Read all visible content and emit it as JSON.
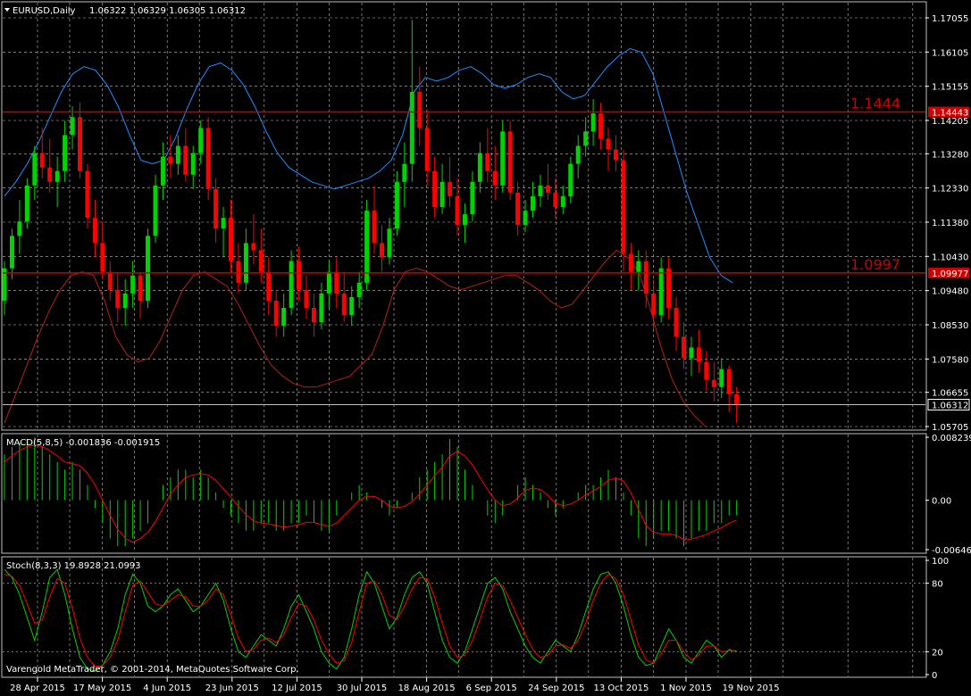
{
  "chart_data": {
    "type": "candlestick",
    "title": "EURUSD,Daily",
    "ohlc_values": "1.06322 1.06329 1.06305 1.06312",
    "colors": {
      "bull": "#00d400",
      "bear": "#ff0000",
      "grid": "#c0c0c0",
      "bb_upper": "#1e90ff",
      "bb_lower": "#b22222",
      "hline": "#cc0000",
      "last": "#c0c0c0"
    },
    "ylim": [
      1.05705,
      1.17055
    ],
    "y_ticks": [
      "1.17055",
      "1.16105",
      "1.15155",
      "1.14205",
      "1.13280",
      "1.12330",
      "1.11380",
      "1.10430",
      "1.09480",
      "1.08530",
      "1.07580",
      "1.06655",
      "1.05705"
    ],
    "x_labels": [
      "28 Apr 2015",
      "17 May 2015",
      "4 Jun 2015",
      "23 Jun 2015",
      "12 Jul 2015",
      "30 Jul 2015",
      "18 Aug 2015",
      "6 Sep 2015",
      "24 Sep 2015",
      "13 Oct 2015",
      "1 Nov 2015",
      "19 Nov 2015"
    ],
    "last_price": {
      "value": 1.06312,
      "label": "1.06312"
    },
    "hlines": [
      {
        "value": 1.1444,
        "tag": "1.14443",
        "label": "1.1444"
      },
      {
        "value": 1.0997,
        "tag": "1.09977",
        "label": "1.0997"
      }
    ],
    "bollinger_upper": [
      1.121,
      1.125,
      1.13,
      1.136,
      1.143,
      1.15,
      1.155,
      1.157,
      1.156,
      1.152,
      1.146,
      1.138,
      1.131,
      1.13,
      1.131,
      1.137,
      1.145,
      1.152,
      1.157,
      1.158,
      1.156,
      1.152,
      1.146,
      1.139,
      1.133,
      1.129,
      1.127,
      1.125,
      1.124,
      1.123,
      1.124,
      1.125,
      1.126,
      1.128,
      1.131,
      1.138,
      1.15,
      1.154,
      1.153,
      1.154,
      1.156,
      1.157,
      1.155,
      1.152,
      1.151,
      1.152,
      1.154,
      1.155,
      1.154,
      1.15,
      1.148,
      1.149,
      1.153,
      1.157,
      1.16,
      1.162,
      1.161,
      1.155,
      1.144,
      1.133,
      1.122,
      1.113,
      1.104,
      1.099,
      1.097
    ],
    "bollinger_lower": [
      1.058,
      1.066,
      1.074,
      1.082,
      1.089,
      1.095,
      1.099,
      1.1,
      1.099,
      1.092,
      1.082,
      1.077,
      1.075,
      1.076,
      1.081,
      1.088,
      1.095,
      1.099,
      1.1,
      1.098,
      1.096,
      1.091,
      1.085,
      1.079,
      1.074,
      1.071,
      1.069,
      1.068,
      1.068,
      1.069,
      1.07,
      1.071,
      1.074,
      1.077,
      1.085,
      1.095,
      1.1,
      1.101,
      1.1,
      1.098,
      1.096,
      1.095,
      1.096,
      1.097,
      1.098,
      1.099,
      1.099,
      1.097,
      1.095,
      1.092,
      1.09,
      1.091,
      1.095,
      1.099,
      1.103,
      1.106,
      1.104,
      1.1,
      1.09,
      1.079,
      1.07,
      1.064,
      1.06,
      1.057
    ],
    "candles": [
      [
        1.092,
        1.103,
        1.088,
        1.101
      ],
      [
        1.101,
        1.112,
        1.098,
        1.11
      ],
      [
        1.11,
        1.12,
        1.105,
        1.114
      ],
      [
        1.114,
        1.126,
        1.112,
        1.124
      ],
      [
        1.124,
        1.135,
        1.12,
        1.133
      ],
      [
        1.133,
        1.14,
        1.126,
        1.129
      ],
      [
        1.129,
        1.137,
        1.122,
        1.125
      ],
      [
        1.125,
        1.132,
        1.118,
        1.128
      ],
      [
        1.128,
        1.142,
        1.125,
        1.138
      ],
      [
        1.138,
        1.146,
        1.134,
        1.143
      ],
      [
        1.143,
        1.147,
        1.126,
        1.128
      ],
      [
        1.128,
        1.13,
        1.112,
        1.115
      ],
      [
        1.115,
        1.12,
        1.104,
        1.108
      ],
      [
        1.108,
        1.114,
        1.098,
        1.1
      ],
      [
        1.1,
        1.103,
        1.092,
        1.095
      ],
      [
        1.095,
        1.1,
        1.086,
        1.09
      ],
      [
        1.09,
        1.098,
        1.085,
        1.094
      ],
      [
        1.094,
        1.103,
        1.09,
        1.099
      ],
      [
        1.099,
        1.1,
        1.087,
        1.092
      ],
      [
        1.092,
        1.112,
        1.09,
        1.11
      ],
      [
        1.11,
        1.127,
        1.108,
        1.124
      ],
      [
        1.124,
        1.136,
        1.12,
        1.132
      ],
      [
        1.132,
        1.138,
        1.126,
        1.13
      ],
      [
        1.13,
        1.138,
        1.127,
        1.135
      ],
      [
        1.135,
        1.14,
        1.125,
        1.127
      ],
      [
        1.127,
        1.135,
        1.123,
        1.133
      ],
      [
        1.133,
        1.142,
        1.13,
        1.14
      ],
      [
        1.14,
        1.143,
        1.12,
        1.123
      ],
      [
        1.123,
        1.126,
        1.108,
        1.112
      ],
      [
        1.112,
        1.118,
        1.104,
        1.115
      ],
      [
        1.115,
        1.12,
        1.1,
        1.103
      ],
      [
        1.103,
        1.108,
        1.094,
        1.097
      ],
      [
        1.097,
        1.112,
        1.095,
        1.108
      ],
      [
        1.108,
        1.116,
        1.102,
        1.106
      ],
      [
        1.106,
        1.112,
        1.097,
        1.1
      ],
      [
        1.1,
        1.104,
        1.088,
        1.092
      ],
      [
        1.092,
        1.095,
        1.082,
        1.085
      ],
      [
        1.085,
        1.094,
        1.082,
        1.09
      ],
      [
        1.09,
        1.106,
        1.088,
        1.103
      ],
      [
        1.103,
        1.107,
        1.092,
        1.095
      ],
      [
        1.095,
        1.099,
        1.087,
        1.09
      ],
      [
        1.09,
        1.094,
        1.082,
        1.086
      ],
      [
        1.086,
        1.097,
        1.084,
        1.094
      ],
      [
        1.094,
        1.103,
        1.09,
        1.1
      ],
      [
        1.1,
        1.104,
        1.09,
        1.094
      ],
      [
        1.094,
        1.1,
        1.086,
        1.088
      ],
      [
        1.088,
        1.096,
        1.085,
        1.093
      ],
      [
        1.093,
        1.1,
        1.09,
        1.097
      ],
      [
        1.097,
        1.12,
        1.095,
        1.117
      ],
      [
        1.117,
        1.124,
        1.105,
        1.108
      ],
      [
        1.108,
        1.113,
        1.1,
        1.104
      ],
      [
        1.104,
        1.115,
        1.102,
        1.112
      ],
      [
        1.112,
        1.128,
        1.11,
        1.125
      ],
      [
        1.125,
        1.136,
        1.118,
        1.13
      ],
      [
        1.13,
        1.17,
        1.125,
        1.15
      ],
      [
        1.15,
        1.157,
        1.135,
        1.14
      ],
      [
        1.14,
        1.145,
        1.124,
        1.128
      ],
      [
        1.128,
        1.132,
        1.115,
        1.118
      ],
      [
        1.118,
        1.13,
        1.116,
        1.125
      ],
      [
        1.125,
        1.132,
        1.118,
        1.121
      ],
      [
        1.121,
        1.126,
        1.11,
        1.113
      ],
      [
        1.113,
        1.119,
        1.108,
        1.116
      ],
      [
        1.116,
        1.128,
        1.114,
        1.125
      ],
      [
        1.125,
        1.136,
        1.122,
        1.133
      ],
      [
        1.133,
        1.14,
        1.125,
        1.128
      ],
      [
        1.128,
        1.135,
        1.12,
        1.124
      ],
      [
        1.124,
        1.142,
        1.122,
        1.139
      ],
      [
        1.139,
        1.142,
        1.12,
        1.122
      ],
      [
        1.122,
        1.125,
        1.11,
        1.113
      ],
      [
        1.113,
        1.12,
        1.111,
        1.117
      ],
      [
        1.117,
        1.125,
        1.115,
        1.121
      ],
      [
        1.121,
        1.127,
        1.118,
        1.124
      ],
      [
        1.124,
        1.13,
        1.12,
        1.122
      ],
      [
        1.122,
        1.126,
        1.115,
        1.118
      ],
      [
        1.118,
        1.124,
        1.116,
        1.121
      ],
      [
        1.121,
        1.132,
        1.119,
        1.13
      ],
      [
        1.13,
        1.138,
        1.126,
        1.135
      ],
      [
        1.135,
        1.143,
        1.132,
        1.139
      ],
      [
        1.139,
        1.148,
        1.135,
        1.144
      ],
      [
        1.144,
        1.147,
        1.134,
        1.137
      ],
      [
        1.137,
        1.14,
        1.128,
        1.134
      ],
      [
        1.134,
        1.138,
        1.128,
        1.131
      ],
      [
        1.131,
        1.134,
        1.1,
        1.105
      ],
      [
        1.105,
        1.108,
        1.095,
        1.1
      ],
      [
        1.1,
        1.106,
        1.095,
        1.103
      ],
      [
        1.103,
        1.106,
        1.09,
        1.094
      ],
      [
        1.094,
        1.098,
        1.084,
        1.088
      ],
      [
        1.088,
        1.104,
        1.086,
        1.101
      ],
      [
        1.101,
        1.104,
        1.087,
        1.09
      ],
      [
        1.09,
        1.093,
        1.078,
        1.082
      ],
      [
        1.082,
        1.086,
        1.073,
        1.076
      ],
      [
        1.076,
        1.082,
        1.071,
        1.079
      ],
      [
        1.079,
        1.084,
        1.072,
        1.075
      ],
      [
        1.075,
        1.078,
        1.067,
        1.07
      ],
      [
        1.07,
        1.075,
        1.064,
        1.068
      ],
      [
        1.068,
        1.076,
        1.065,
        1.073
      ],
      [
        1.073,
        1.074,
        1.061,
        1.066
      ],
      [
        1.066,
        1.068,
        1.058,
        1.063
      ]
    ],
    "macd": {
      "label": "MACD(5,8,5) -0.001836 -0.001915",
      "ylim": [
        -0.006469,
        0.008239
      ],
      "y_ticks": [
        "0.008239",
        "0.00",
        "-0.006469"
      ],
      "hist": [
        0.006,
        0.007,
        0.0075,
        0.008,
        0.0082,
        0.007,
        0.006,
        0.005,
        0.004,
        0.005,
        0.004,
        0.002,
        -0.001,
        -0.003,
        -0.005,
        -0.006,
        -0.006,
        -0.005,
        -0.004,
        -0.003,
        0.0,
        0.002,
        0.003,
        0.004,
        0.004,
        0.003,
        0.004,
        0.003,
        0.001,
        -0.001,
        -0.002,
        -0.003,
        -0.004,
        -0.004,
        -0.003,
        -0.003,
        -0.004,
        -0.004,
        -0.003,
        -0.003,
        -0.002,
        -0.003,
        -0.004,
        -0.004,
        -0.002,
        0.0,
        0.001,
        0.002,
        0.001,
        0.0,
        -0.001,
        -0.002,
        -0.001,
        0.0,
        0.001,
        0.003,
        0.004,
        0.005,
        0.006,
        0.008,
        0.007,
        0.004,
        0.002,
        0.0,
        -0.002,
        -0.003,
        -0.002,
        0.0,
        0.002,
        0.003,
        0.002,
        0.001,
        -0.001,
        -0.002,
        -0.001,
        0.0,
        0.001,
        0.002,
        0.002,
        0.003,
        0.004,
        0.003,
        0.001,
        -0.002,
        -0.005,
        -0.006,
        -0.005,
        -0.004,
        -0.004,
        -0.005,
        -0.006,
        -0.005,
        -0.004,
        -0.004,
        -0.003,
        -0.003,
        -0.002,
        -0.002
      ],
      "signal": [
        0.005,
        0.0058,
        0.0065,
        0.007,
        0.0072,
        0.007,
        0.0065,
        0.0058,
        0.005,
        0.0048,
        0.0045,
        0.0035,
        0.002,
        0.0,
        -0.002,
        -0.0038,
        -0.005,
        -0.0055,
        -0.005,
        -0.0042,
        -0.0028,
        -0.001,
        0.0008,
        0.002,
        0.003,
        0.0033,
        0.0035,
        0.0033,
        0.0026,
        0.0015,
        0.0004,
        -0.0008,
        -0.0019,
        -0.0027,
        -0.003,
        -0.0031,
        -0.0033,
        -0.0035,
        -0.0034,
        -0.0032,
        -0.0029,
        -0.0029,
        -0.0032,
        -0.0034,
        -0.003,
        -0.002,
        -0.001,
        0.0,
        0.0005,
        0.0005,
        0.0,
        -0.0008,
        -0.001,
        -0.0008,
        -0.0002,
        0.0008,
        0.002,
        0.0032,
        0.0043,
        0.0058,
        0.0064,
        0.0058,
        0.0046,
        0.003,
        0.0014,
        0.0,
        -0.0007,
        -0.0005,
        0.0003,
        0.0013,
        0.0016,
        0.0014,
        0.0006,
        -0.0004,
        -0.0007,
        -0.0005,
        0.0,
        0.0007,
        0.0012,
        0.0018,
        0.0026,
        0.0029,
        0.0025,
        0.001,
        -0.0012,
        -0.0033,
        -0.0042,
        -0.0044,
        -0.0044,
        -0.0046,
        -0.0051,
        -0.0051,
        -0.0048,
        -0.0045,
        -0.004,
        -0.0036,
        -0.003,
        -0.0026
      ]
    },
    "stoch": {
      "label": "Stoch(8,3,3) 19.8928 21.0993",
      "ylim": [
        0,
        100
      ],
      "y_ticks": [
        "100",
        "80",
        "20",
        "0"
      ],
      "main": [
        92,
        85,
        70,
        50,
        30,
        55,
        85,
        92,
        70,
        40,
        15,
        5,
        3,
        8,
        20,
        40,
        70,
        88,
        80,
        60,
        55,
        60,
        70,
        75,
        65,
        55,
        60,
        70,
        80,
        65,
        40,
        20,
        15,
        25,
        35,
        30,
        25,
        40,
        60,
        70,
        55,
        40,
        20,
        10,
        5,
        15,
        40,
        70,
        90,
        80,
        60,
        40,
        50,
        70,
        85,
        90,
        80,
        55,
        30,
        15,
        10,
        20,
        40,
        60,
        80,
        85,
        75,
        55,
        40,
        25,
        15,
        10,
        20,
        30,
        25,
        20,
        35,
        55,
        75,
        88,
        90,
        80,
        60,
        35,
        15,
        8,
        10,
        25,
        40,
        30,
        15,
        10,
        20,
        30,
        25,
        15,
        22,
        20
      ],
      "signal": [
        88,
        86,
        78,
        62,
        45,
        48,
        68,
        84,
        80,
        58,
        32,
        15,
        7,
        8,
        15,
        30,
        55,
        78,
        82,
        72,
        62,
        60,
        65,
        70,
        68,
        60,
        60,
        65,
        75,
        70,
        52,
        32,
        20,
        22,
        30,
        32,
        28,
        35,
        50,
        62,
        60,
        48,
        30,
        18,
        10,
        12,
        28,
        55,
        80,
        82,
        70,
        52,
        48,
        60,
        75,
        85,
        84,
        68,
        45,
        25,
        15,
        17,
        30,
        48,
        68,
        80,
        78,
        65,
        50,
        35,
        22,
        15,
        17,
        25,
        26,
        23,
        30,
        45,
        65,
        80,
        88,
        84,
        70,
        48,
        26,
        13,
        10,
        18,
        30,
        30,
        20,
        13,
        17,
        25,
        25,
        20,
        21,
        21
      ]
    },
    "watermark": "Varengold MetaTrader, © 2001-2014, MetaQuotes Software Corp."
  }
}
